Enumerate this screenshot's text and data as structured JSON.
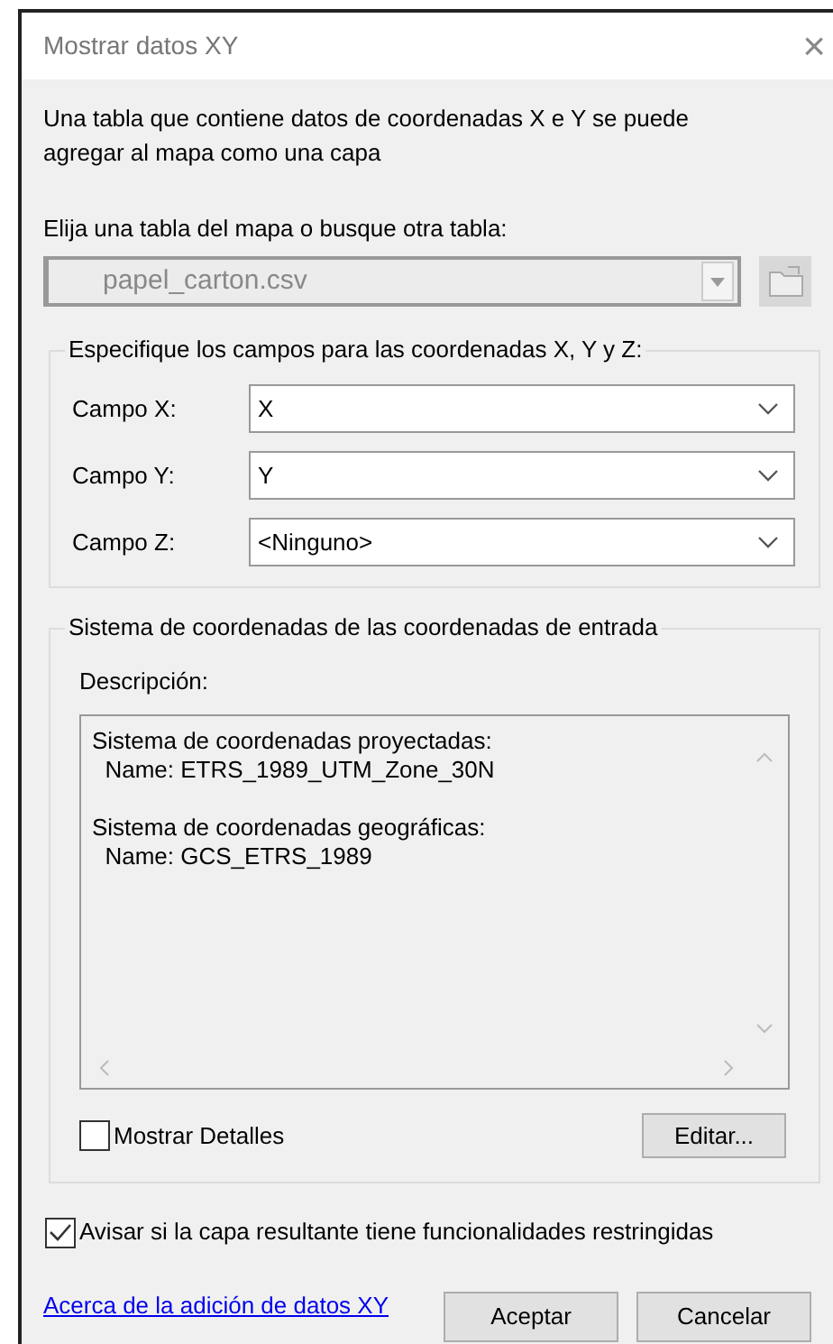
{
  "window": {
    "title": "Mostrar datos XY",
    "close": "×"
  },
  "intro": "Una tabla que contiene datos de coordenadas X e Y se puede agregar al mapa como una capa",
  "table_label": "Elija una tabla del mapa o busque otra tabla:",
  "table_combo": {
    "value": "papel_carton.csv",
    "disabled": true
  },
  "fields_group": {
    "title": "Especifique los campos para las coordenadas X, Y y Z:",
    "fields": [
      {
        "label": "Campo X:",
        "value": "X"
      },
      {
        "label": "Campo Y:",
        "value": "Y"
      },
      {
        "label": "Campo Z:",
        "value": "<Ninguno>"
      }
    ]
  },
  "coord_group": {
    "title": "Sistema de coordenadas de las coordenadas de entrada",
    "description_label": "Descripción:",
    "description_blocks": [
      [
        "Sistema de coordenadas proyectadas:",
        "  Name: ETRS_1989_UTM_Zone_30N"
      ],
      [
        "Sistema de coordenadas geográficas:",
        "  Name: GCS_ETRS_1989"
      ]
    ],
    "show_details": {
      "label": "Mostrar Detalles",
      "checked": false
    },
    "edit_button": "Editar..."
  },
  "warn": {
    "label": "Avisar si la capa resultante tiene funcionalidades restringidas",
    "checked": true
  },
  "help_link": "Acerca de la adición de datos XY",
  "buttons": [
    "Aceptar",
    "Cancelar"
  ]
}
